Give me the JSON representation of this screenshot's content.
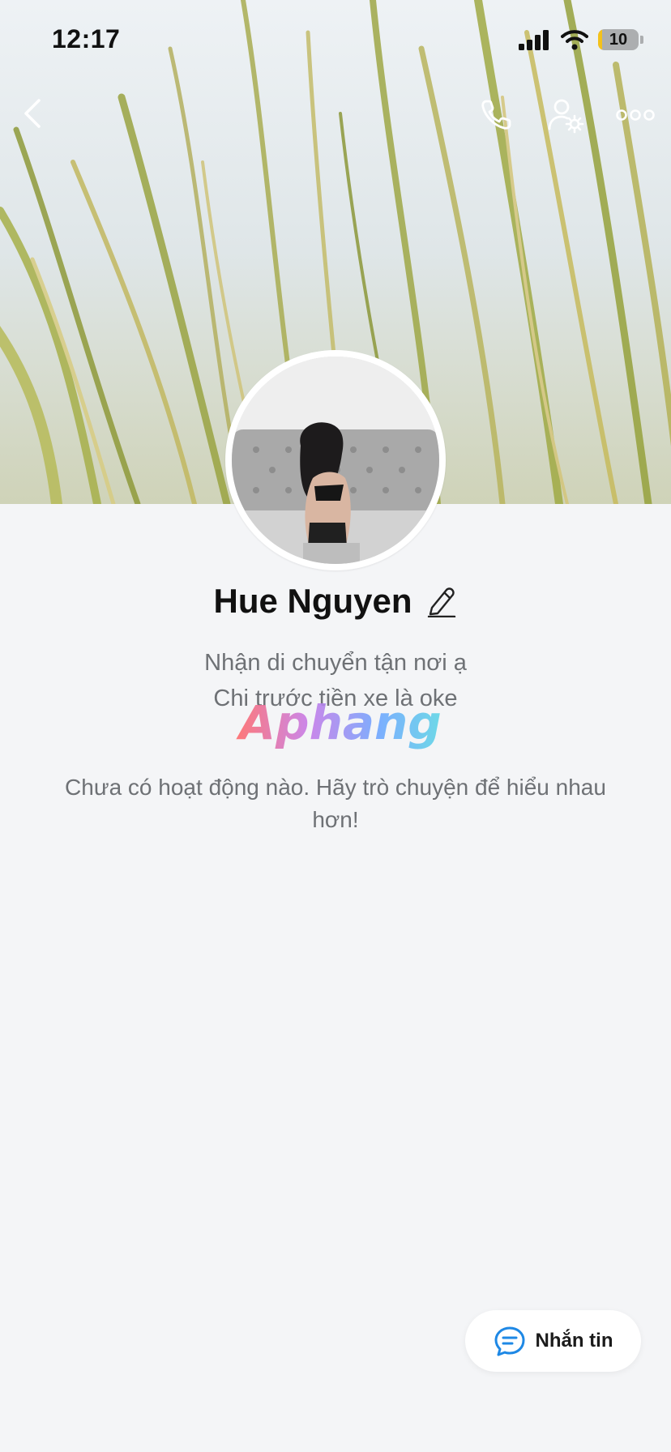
{
  "status_bar": {
    "time": "12:17",
    "battery_level": "10",
    "battery_fraction": 0.1
  },
  "nav": {
    "back_icon": "chevron-left-icon",
    "call_icon": "phone-icon",
    "settings_icon": "user-settings-icon",
    "more_icon": "more-horizontal-icon"
  },
  "profile": {
    "name": "Hue Nguyen",
    "bio_line1": "Nhận di chuyển tận nơi ạ",
    "bio_line2": "Chi trước tiền xe là oke"
  },
  "watermark": {
    "text": "Aphang"
  },
  "empty_state": {
    "text": "Chưa có hoạt động nào. Hãy trò chuyện để hiểu nhau hơn!"
  },
  "message_button": {
    "label": "Nhắn tin",
    "icon": "chat-bubble-icon"
  },
  "colors": {
    "background": "#f4f5f7",
    "accent": "#1e88e5",
    "text_primary": "#111111",
    "text_secondary": "#6e7175"
  }
}
